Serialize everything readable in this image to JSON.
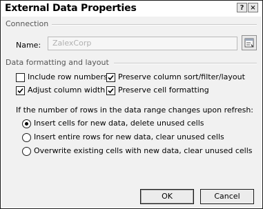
{
  "window": {
    "title": "External Data Properties",
    "help_glyph": "?",
    "close_glyph": "×"
  },
  "connection": {
    "group_label": "Connection",
    "name_label": "Name:",
    "name_value": "ZalexCorp"
  },
  "formatting": {
    "group_label": "Data formatting and layout",
    "checkboxes": [
      {
        "label": "Include row numbers",
        "checked": false
      },
      {
        "label": "Preserve column sort/filter/layout",
        "checked": true
      },
      {
        "label": "Adjust column width",
        "checked": true
      },
      {
        "label": "Preserve cell formatting",
        "checked": true
      }
    ]
  },
  "refresh": {
    "prompt": "If the number of rows in the data range changes upon refresh:",
    "options": [
      {
        "label": "Insert cells for new data, delete unused cells",
        "selected": true
      },
      {
        "label": "Insert entire rows for new data, clear unused cells",
        "selected": false
      },
      {
        "label": "Overwrite existing cells with new data, clear unused cells",
        "selected": false
      }
    ]
  },
  "buttons": {
    "ok": "OK",
    "cancel": "Cancel"
  }
}
